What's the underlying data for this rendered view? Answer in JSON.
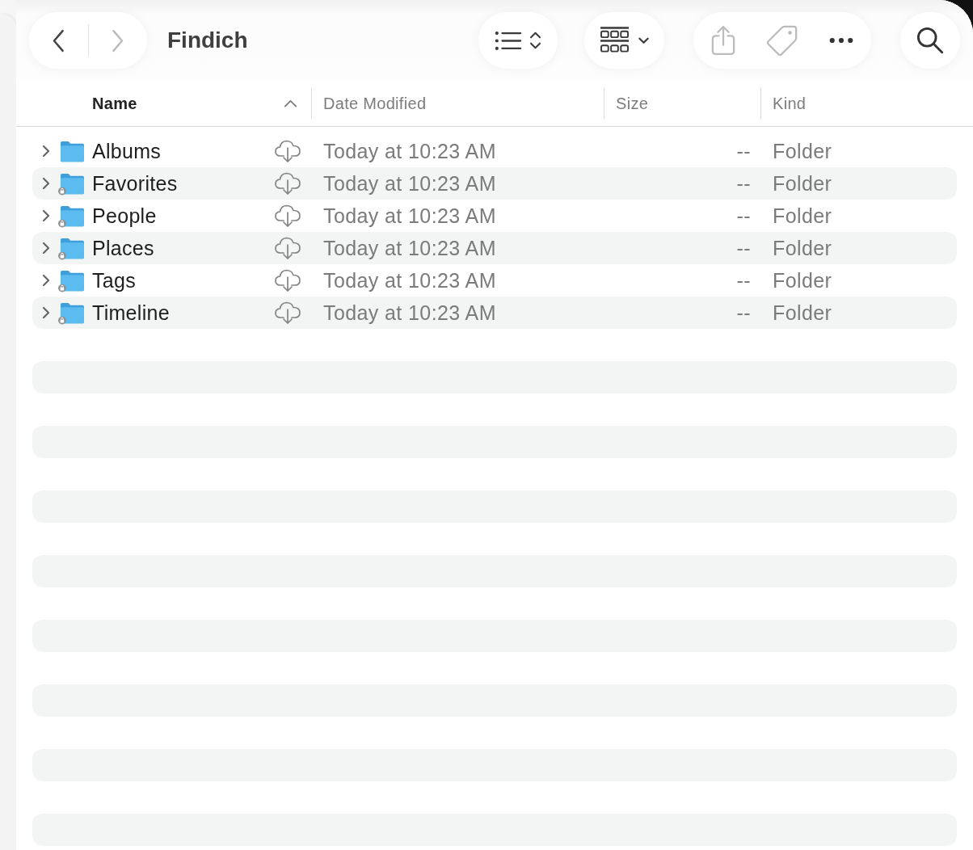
{
  "toolbar": {
    "back_button": {
      "disabled": false
    },
    "forward_button": {
      "disabled": true
    },
    "title": "Findich",
    "share_button": {
      "disabled": true
    },
    "tag_button": {
      "disabled": true
    },
    "more_button": {
      "disabled": false
    }
  },
  "columns": [
    {
      "label": "Name",
      "sorted": true,
      "sort_descending": false
    },
    {
      "label": "Date Modified",
      "sorted": false
    },
    {
      "label": "Size",
      "sorted": false
    },
    {
      "label": "Kind",
      "sorted": false
    }
  ],
  "rows": [
    {
      "name": "Albums",
      "locked": false,
      "expanded": false,
      "date_modified": "Today at 10:23 AM",
      "size": "--",
      "file_kind": "Folder"
    },
    {
      "name": "Favorites",
      "locked": true,
      "expanded": false,
      "date_modified": "Today at 10:23 AM",
      "size": "--",
      "file_kind": "Folder"
    },
    {
      "name": "People",
      "locked": true,
      "expanded": false,
      "date_modified": "Today at 10:23 AM",
      "size": "--",
      "file_kind": "Folder"
    },
    {
      "name": "Places",
      "locked": true,
      "expanded": false,
      "date_modified": "Today at 10:23 AM",
      "size": "--",
      "file_kind": "Folder"
    },
    {
      "name": "Tags",
      "locked": true,
      "expanded": false,
      "date_modified": "Today at 10:23 AM",
      "size": "--",
      "file_kind": "Folder"
    },
    {
      "name": "Timeline",
      "locked": true,
      "expanded": false,
      "date_modified": "Today at 10:23 AM",
      "size": "--",
      "file_kind": "Folder"
    }
  ]
}
